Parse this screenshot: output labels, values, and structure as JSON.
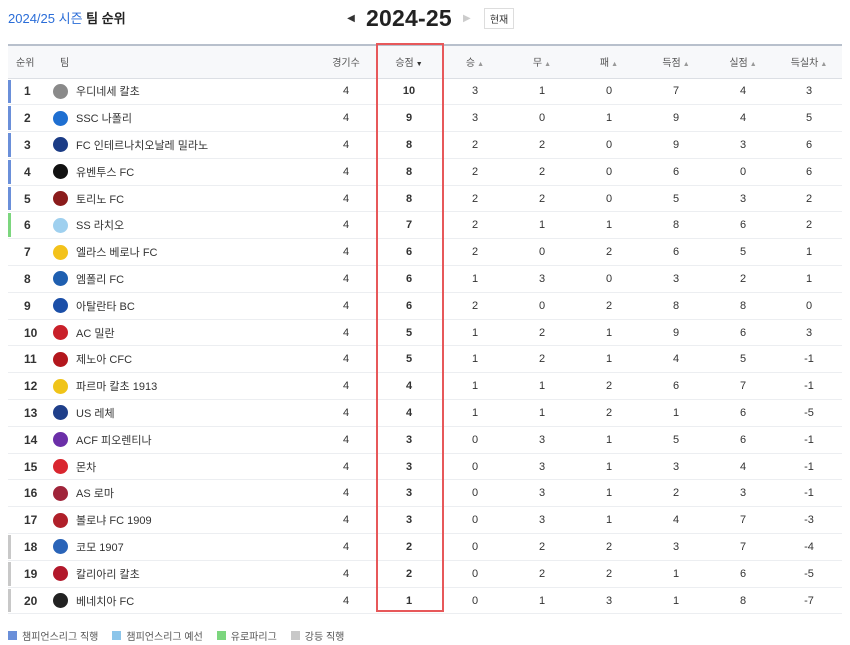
{
  "header": {
    "season_label": "2024/25 시즌",
    "title_suffix": "팀 순위",
    "year": "2024-25",
    "prev_icon": "left-triangle",
    "next_icon": "right-triangle",
    "now_label": "현재"
  },
  "columns": {
    "rank": "순위",
    "team": "팀",
    "played": "경기수",
    "points": "승점",
    "wins": "승",
    "draws": "무",
    "losses": "패",
    "goals_for": "득점",
    "goals_against": "실점",
    "goal_diff": "득실차"
  },
  "colors": {
    "ucl": "#6a8fd9",
    "ucl_qual": "#8cc5ea",
    "uel": "#7cd67e",
    "relegation": "#c8c8c8",
    "highlight": "#e7585a"
  },
  "rows": [
    {
      "rank": "1",
      "team": "우디네세 칼초",
      "played": "4",
      "points": "10",
      "w": "3",
      "d": "1",
      "l": "0",
      "gf": "7",
      "ga": "4",
      "gd": "3",
      "zone": "ucl",
      "logo_color": "#8a8a8a"
    },
    {
      "rank": "2",
      "team": "SSC 나폴리",
      "played": "4",
      "points": "9",
      "w": "3",
      "d": "0",
      "l": "1",
      "gf": "9",
      "ga": "4",
      "gd": "5",
      "zone": "ucl",
      "logo_color": "#1f6fd1"
    },
    {
      "rank": "3",
      "team": "FC 인테르나치오날레 밀라노",
      "played": "4",
      "points": "8",
      "w": "2",
      "d": "2",
      "l": "0",
      "gf": "9",
      "ga": "3",
      "gd": "6",
      "zone": "ucl",
      "logo_color": "#1b3c86"
    },
    {
      "rank": "4",
      "team": "유벤투스 FC",
      "played": "4",
      "points": "8",
      "w": "2",
      "d": "2",
      "l": "0",
      "gf": "6",
      "ga": "0",
      "gd": "6",
      "zone": "ucl",
      "logo_color": "#111111"
    },
    {
      "rank": "5",
      "team": "토리노 FC",
      "played": "4",
      "points": "8",
      "w": "2",
      "d": "2",
      "l": "0",
      "gf": "5",
      "ga": "3",
      "gd": "2",
      "zone": "ucl",
      "logo_color": "#8b1c1c"
    },
    {
      "rank": "6",
      "team": "SS 라치오",
      "played": "4",
      "points": "7",
      "w": "2",
      "d": "1",
      "l": "1",
      "gf": "8",
      "ga": "6",
      "gd": "2",
      "zone": "uel",
      "logo_color": "#9fd0ef"
    },
    {
      "rank": "7",
      "team": "엘라스 베로나 FC",
      "played": "4",
      "points": "6",
      "w": "2",
      "d": "0",
      "l": "2",
      "gf": "6",
      "ga": "5",
      "gd": "1",
      "zone": "",
      "logo_color": "#f3c21b"
    },
    {
      "rank": "8",
      "team": "엠폴리 FC",
      "played": "4",
      "points": "6",
      "w": "1",
      "d": "3",
      "l": "0",
      "gf": "3",
      "ga": "2",
      "gd": "1",
      "zone": "",
      "logo_color": "#1f5fb0"
    },
    {
      "rank": "9",
      "team": "아탈란타 BC",
      "played": "4",
      "points": "6",
      "w": "2",
      "d": "0",
      "l": "2",
      "gf": "8",
      "ga": "8",
      "gd": "0",
      "zone": "",
      "logo_color": "#1b4fa8"
    },
    {
      "rank": "10",
      "team": "AC 밀란",
      "played": "4",
      "points": "5",
      "w": "1",
      "d": "2",
      "l": "1",
      "gf": "9",
      "ga": "6",
      "gd": "3",
      "zone": "",
      "logo_color": "#c9202a"
    },
    {
      "rank": "11",
      "team": "제노아 CFC",
      "played": "4",
      "points": "5",
      "w": "1",
      "d": "2",
      "l": "1",
      "gf": "4",
      "ga": "5",
      "gd": "-1",
      "zone": "",
      "logo_color": "#b3171d"
    },
    {
      "rank": "12",
      "team": "파르마 칼초 1913",
      "played": "4",
      "points": "4",
      "w": "1",
      "d": "1",
      "l": "2",
      "gf": "6",
      "ga": "7",
      "gd": "-1",
      "zone": "",
      "logo_color": "#f0c419"
    },
    {
      "rank": "13",
      "team": "US 레체",
      "played": "4",
      "points": "4",
      "w": "1",
      "d": "1",
      "l": "2",
      "gf": "1",
      "ga": "6",
      "gd": "-5",
      "zone": "",
      "logo_color": "#1f3f8a"
    },
    {
      "rank": "14",
      "team": "ACF 피오렌티나",
      "played": "4",
      "points": "3",
      "w": "0",
      "d": "3",
      "l": "1",
      "gf": "5",
      "ga": "6",
      "gd": "-1",
      "zone": "",
      "logo_color": "#6b2fa8"
    },
    {
      "rank": "15",
      "team": "몬차",
      "played": "4",
      "points": "3",
      "w": "0",
      "d": "3",
      "l": "1",
      "gf": "3",
      "ga": "4",
      "gd": "-1",
      "zone": "",
      "logo_color": "#d9262f"
    },
    {
      "rank": "16",
      "team": "AS 로마",
      "played": "4",
      "points": "3",
      "w": "0",
      "d": "3",
      "l": "1",
      "gf": "2",
      "ga": "3",
      "gd": "-1",
      "zone": "",
      "logo_color": "#a0243a"
    },
    {
      "rank": "17",
      "team": "볼로냐 FC 1909",
      "played": "4",
      "points": "3",
      "w": "0",
      "d": "3",
      "l": "1",
      "gf": "4",
      "ga": "7",
      "gd": "-3",
      "zone": "",
      "logo_color": "#b0202a"
    },
    {
      "rank": "18",
      "team": "코모 1907",
      "played": "4",
      "points": "2",
      "w": "0",
      "d": "2",
      "l": "2",
      "gf": "3",
      "ga": "7",
      "gd": "-4",
      "zone": "relegation",
      "logo_color": "#2a64b8"
    },
    {
      "rank": "19",
      "team": "칼리아리 칼초",
      "played": "4",
      "points": "2",
      "w": "0",
      "d": "2",
      "l": "2",
      "gf": "1",
      "ga": "6",
      "gd": "-5",
      "zone": "relegation",
      "logo_color": "#b2182b"
    },
    {
      "rank": "20",
      "team": "베네치아 FC",
      "played": "4",
      "points": "1",
      "w": "0",
      "d": "1",
      "l": "3",
      "gf": "1",
      "ga": "8",
      "gd": "-7",
      "zone": "relegation",
      "logo_color": "#222222"
    }
  ],
  "legend": [
    {
      "label": "챔피언스리그 직행",
      "color": "#6a8fd9"
    },
    {
      "label": "챔피언스리그 예선",
      "color": "#8cc5ea"
    },
    {
      "label": "유로파리그",
      "color": "#7cd67e"
    },
    {
      "label": "강등 직행",
      "color": "#c8c8c8"
    }
  ]
}
